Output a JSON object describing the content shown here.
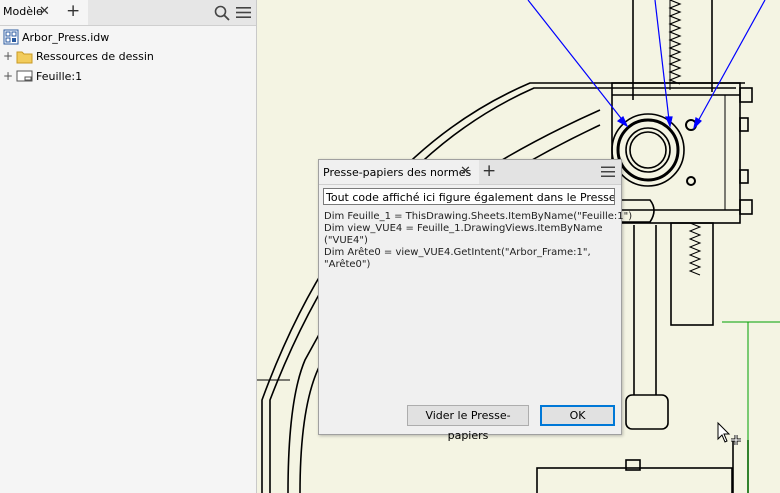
{
  "browser": {
    "tab_label": "Modèle",
    "close_glyph": "✕",
    "add_glyph": "+",
    "tree": [
      {
        "label": "Arbor_Press.idw",
        "icon": "drawing-file-icon",
        "expander": ""
      },
      {
        "label": "Ressources de dessin",
        "icon": "folder-icon",
        "expander": "+"
      },
      {
        "label": "Feuille:1",
        "icon": "sheet-icon",
        "expander": "+"
      }
    ]
  },
  "dialog": {
    "title": "Presse-papiers des normes",
    "close_glyph": "✕",
    "add_glyph": "+",
    "field_value": "Tout code affiché ici figure également dans le Presse-papiers",
    "code_lines": [
      "Dim Feuille_1 = ThisDrawing.Sheets.ItemByName(\"Feuille:1\")",
      "Dim view_VUE4 = Feuille_1.DrawingViews.ItemByName",
      "(\"VUE4\")",
      "Dim Arête0 = view_VUE4.GetIntent(\"Arbor_Frame:1\",",
      "\"Arête0\")"
    ],
    "clear_button": "Vider le Presse-papiers",
    "ok_button": "OK"
  },
  "colors": {
    "canvas_bg": "#f4f4e3",
    "leader_arrows": "#0000ff",
    "construction_line": "#00a000",
    "ok_border": "#0078d7"
  }
}
